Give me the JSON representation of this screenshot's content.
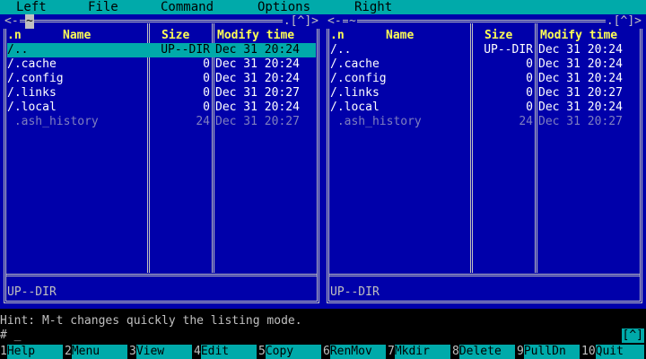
{
  "menubar": {
    "items": [
      "Left",
      "File",
      "Command",
      "Options",
      "Right"
    ]
  },
  "left_panel": {
    "top_left": "<-",
    "tilde": "~",
    "top_right": ".[^]>",
    "columns": {
      "n": ".n",
      "name": "Name",
      "size": "Size",
      "time": "Modify time"
    },
    "rows": [
      {
        "name": "/..",
        "size": "UP--DIR",
        "time": "Dec 31 20:24"
      },
      {
        "name": "/.cache",
        "size": "0",
        "time": "Dec 31 20:24"
      },
      {
        "name": "/.config",
        "size": "0",
        "time": "Dec 31 20:24"
      },
      {
        "name": "/.links",
        "size": "0",
        "time": "Dec 31 20:27"
      },
      {
        "name": "/.local",
        "size": "0",
        "time": "Dec 31 20:24"
      },
      {
        "name": " .ash_history",
        "size": "24",
        "time": "Dec 31 20:27"
      }
    ],
    "status": "UP--DIR"
  },
  "right_panel": {
    "top_left": "<-",
    "tilde": "~",
    "top_right": ".[^]>",
    "columns": {
      "n": ".n",
      "name": "Name",
      "size": "Size",
      "time": "Modify time"
    },
    "rows": [
      {
        "name": "/..",
        "size": "UP--DIR",
        "time": "Dec 31 20:24"
      },
      {
        "name": "/.cache",
        "size": "0",
        "time": "Dec 31 20:24"
      },
      {
        "name": "/.config",
        "size": "0",
        "time": "Dec 31 20:24"
      },
      {
        "name": "/.links",
        "size": "0",
        "time": "Dec 31 20:27"
      },
      {
        "name": "/.local",
        "size": "0",
        "time": "Dec 31 20:24"
      },
      {
        "name": " .ash_history",
        "size": "24",
        "time": "Dec 31 20:27"
      }
    ],
    "status": "UP--DIR"
  },
  "hint": "Hint: M-t changes quickly the listing mode.",
  "command_line": {
    "prompt": "# _",
    "right": "[^]"
  },
  "fkeys": [
    {
      "num": "1",
      "label": "Help"
    },
    {
      "num": "2",
      "label": "Menu"
    },
    {
      "num": "3",
      "label": "View"
    },
    {
      "num": "4",
      "label": "Edit"
    },
    {
      "num": "5",
      "label": "Copy"
    },
    {
      "num": "6",
      "label": "RenMov"
    },
    {
      "num": "7",
      "label": "Mkdir"
    },
    {
      "num": "8",
      "label": "Delete"
    },
    {
      "num": "9",
      "label": "PullDn"
    },
    {
      "num": "10",
      "label": "Quit"
    }
  ],
  "colors": {
    "panel_bg": "#0000aa",
    "accent": "#00aaaa",
    "header": "#ffff55"
  }
}
